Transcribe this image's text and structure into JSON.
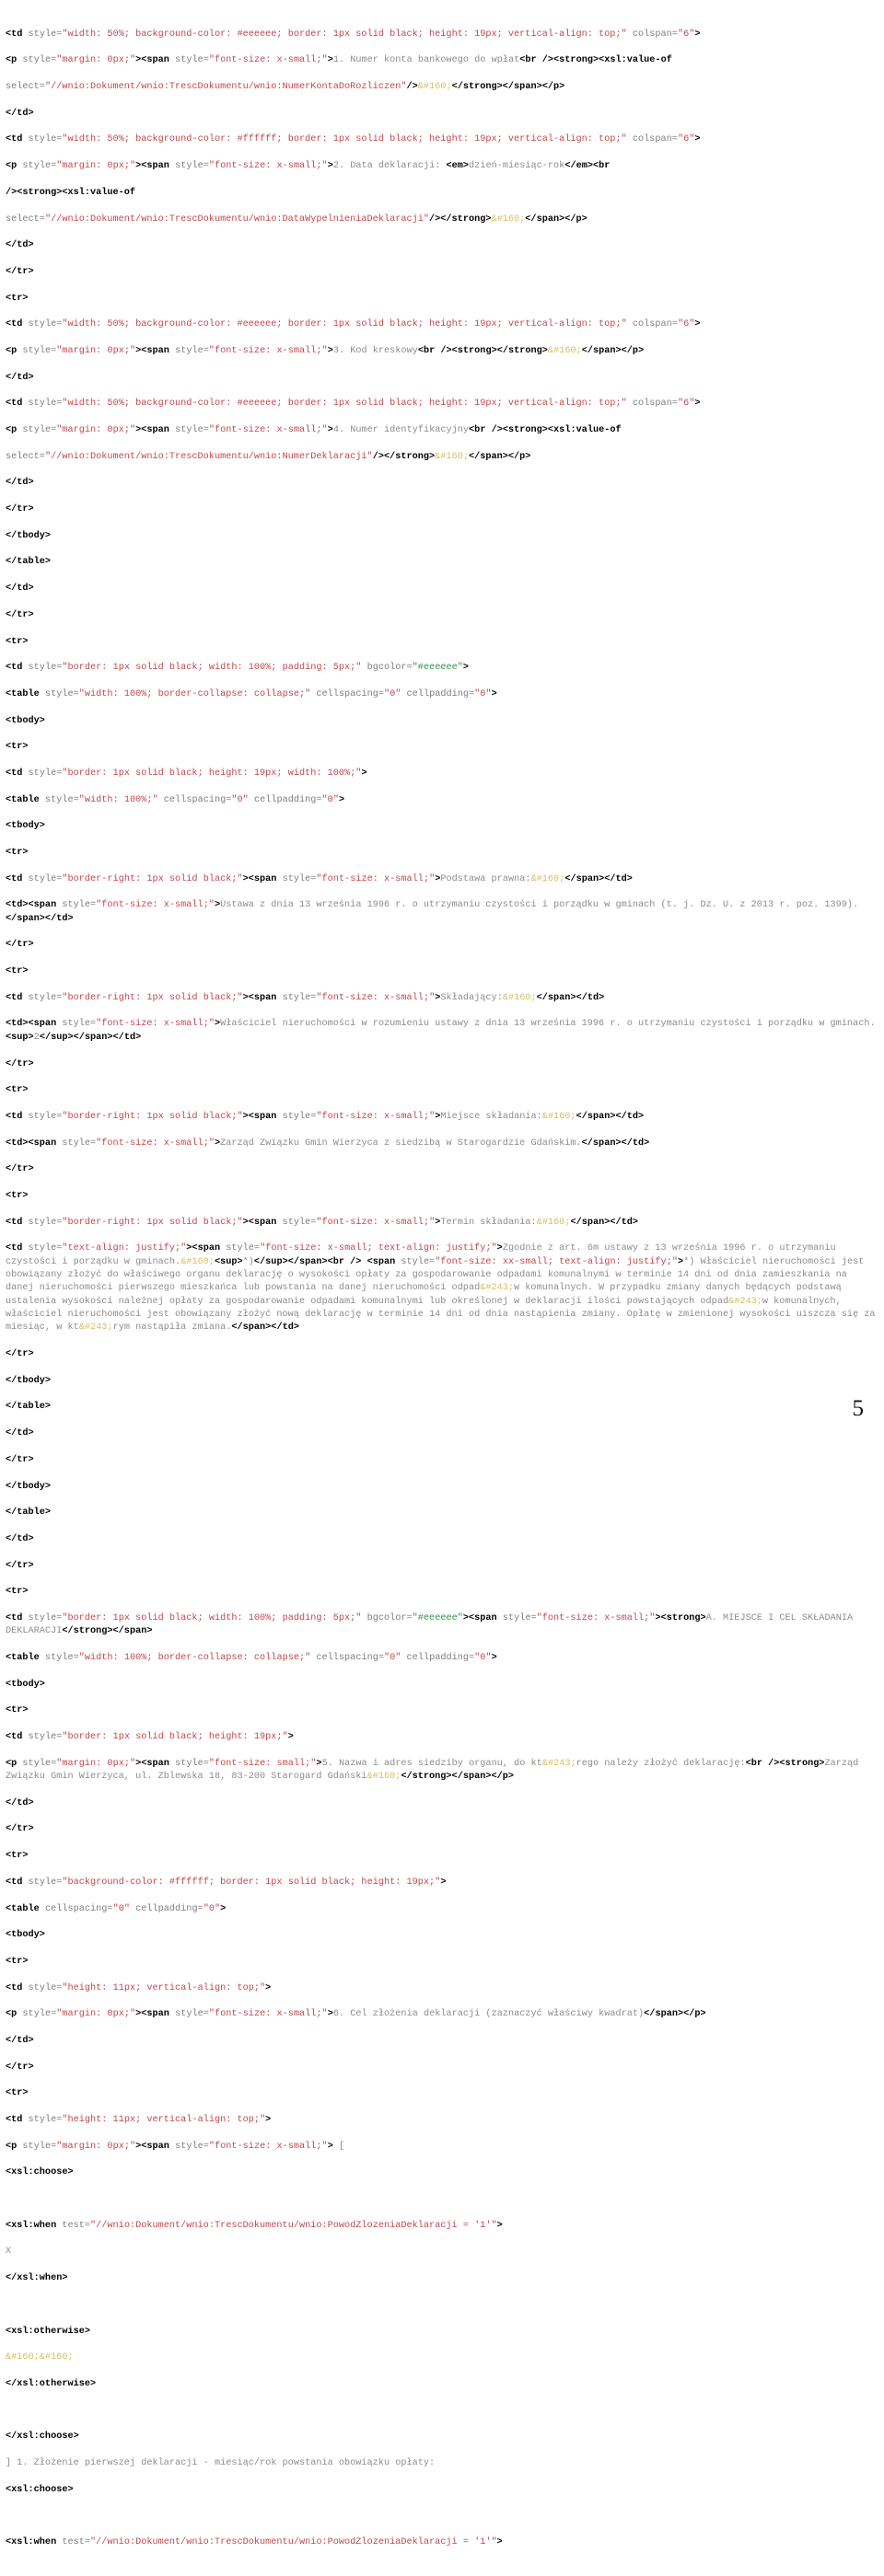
{
  "document": {
    "kind": "xslt-source-listing",
    "page_number": "5",
    "language": "XSLT / XHTML",
    "colors": {
      "background": "#ffffff",
      "tag": "#000000",
      "attribute_name": "#7d7d7d",
      "attribute_value": "#c2484d",
      "attribute_value_green": "#2f8f4e",
      "text": "#8c8c8c",
      "entity": "#d6bf63"
    }
  },
  "code_lines": [
    "<td style=\"width: 50%; background-color: #eeeeee; border: 1px solid black; height: 19px; vertical-align: top;\" colspan=\"6\">",
    "<p style=\"margin: 0px;\"><span style=\"font-size: x-small;\">1. Numer konta bankowego do wpłat<br /><strong><xsl:value-of",
    "select=\"//wnio:Dokument/wnio:TrescDokumentu/wnio:NumerKontaDoRozliczen\"/>&#160;</strong></span></p>",
    "</td>",
    "<td style=\"width: 50%; background-color: #ffffff; border: 1px solid black; height: 19px; vertical-align: top;\" colspan=\"6\">",
    "<p style=\"margin: 0px;\"><span style=\"font-size: x-small;\">2. Data deklaracji: <em>dzień-miesiąc-rok</em><br",
    "/><strong><xsl:value-of",
    "select=\"//wnio:Dokument/wnio:TrescDokumentu/wnio:DataWypelnieniaDeklaracji\"/></strong>&#160;</span></p>",
    "</td>",
    "</tr>",
    "<tr>",
    "<td style=\"width: 50%; background-color: #eeeeee; border: 1px solid black; height: 19px; vertical-align: top;\" colspan=\"6\">",
    "<p style=\"margin: 0px;\"><span style=\"font-size: x-small;\">3. Kod kreskowy<br /><strong></strong>&#160;</span></p>",
    "</td>",
    "<td style=\"width: 50%; background-color: #eeeeee; border: 1px solid black; height: 19px; vertical-align: top;\" colspan=\"6\">",
    "<p style=\"margin: 0px;\"><span style=\"font-size: x-small;\">4. Numer identyfikacyjny<br /><strong><xsl:value-of",
    "select=\"//wnio:Dokument/wnio:TrescDokumentu/wnio:NumerDeklaracji\"/></strong>&#160;</span></p>",
    "</td>",
    "</tr>",
    "</tbody>",
    "</table>",
    "</td>",
    "</tr>",
    "<tr>",
    "<td style=\"border: 1px solid black; width: 100%; padding: 5px;\" bgcolor=\"#eeeeee\">",
    "<table style=\"width: 100%; border-collapse: collapse;\" cellspacing=\"0\" cellpadding=\"0\">",
    "<tbody>",
    "<tr>",
    "<td style=\"border: 1px solid black; height: 19px; width: 100%;\">",
    "<table style=\"width: 100%;\" cellspacing=\"0\" cellpadding=\"0\">",
    "<tbody>",
    "<tr>",
    "<td style=\"border-right: 1px solid black;\"><span style=\"font-size: x-small;\">Podstawa prawna:&#160;</span></td>",
    "<td><span style=\"font-size: x-small;\">Ustawa z dnia 13 września 1996 r. o utrzymaniu czystości i porządku w gminach (t. j. Dz. U. z 2013 r. poz. 1399).</span></td>",
    "</tr>",
    "<tr>",
    "<td style=\"border-right: 1px solid black;\"><span style=\"font-size: x-small;\">Składający:&#160;</span></td>",
    "<td><span style=\"font-size: x-small;\">Właściciel nieruchomości w rozumieniu ustawy z dnia 13 września 1996 r. o utrzymaniu czystości i porządku w gminach.<sup>2</sup></span></td>",
    "</tr>",
    "<tr>",
    "<td style=\"border-right: 1px solid black;\"><span style=\"font-size: x-small;\">Miejsce składania:&#160;</span></td>",
    "<td><span style=\"font-size: x-small;\">Zarząd Związku Gmin Wierzyca z siedzibą w Starogardzie Gdańskim.</span></td>",
    "</tr>",
    "<tr>",
    "<td style=\"border-right: 1px solid black;\"><span style=\"font-size: x-small;\">Termin składania:&#160;</span></td>",
    "<td style=\"text-align: justify;\"><span style=\"font-size: x-small; text-align: justify;\">Zgodnie z art. 6m ustawy z 13 września 1996 r. o utrzymaniu czystości i porządku w gminach.&#160;<sup>*)</sup></span><br /> <span style=\"font-size: xx-small; text-align: justify;\">*) Właściciel nieruchomości jest obowiązany złożyć do właściwego organu deklarację o wysokości opłaty za gospodarowanie odpadami komunalnymi w terminie 14 dni od dnia zamieszkania na danej nieruchomości pierwszego mieszkańca lub powstania na danej nieruchomości odpad&#243;w komunalnych. W przypadku zmiany danych będących podstawą ustalenia wysokości należnej opłaty za gospodarowanie odpadami komunalnymi lub określonej w deklaracji ilości powstających odpad&#243;w komunalnych, właściciel nieruchomości jest obowiązany złożyć nową deklarację w terminie 14 dni od dnia nastąpienia zmiany. Opłatę w zmienionej wysokości uiszcza się za miesiąc, w kt&#243;rym nastąpiła zmiana.</span></td>",
    "</tr>",
    "</tbody>",
    "</table>",
    "</td>",
    "</tr>",
    "</tbody>",
    "</table>",
    "</td>",
    "</tr>",
    "<tr>",
    "<td style=\"border: 1px solid black; width: 100%; padding: 5px;\" bgcolor=\"#eeeeee\"><span style=\"font-size: x-small;\"><strong>A. MIEJSCE I CEL SKŁADANIA DEKLARACJI</strong></span>",
    "<table style=\"width: 100%; border-collapse: collapse;\" cellspacing=\"0\" cellpadding=\"0\">",
    "<tbody>",
    "<tr>",
    "<td style=\"border: 1px solid black; height: 19px;\">",
    "<p style=\"margin: 0px;\"><span style=\"font-size: small;\">5. Nazwa i adres siedziby organu, do kt&#243;rego należy złożyć deklarację:<br /><strong>Zarząd Związku Gmin Wierzyca, ul. Zblewska 18, 83-200 Starogard Gdański&#160;</strong></span></p>",
    "</td>",
    "</tr>",
    "<tr>",
    "<td style=\"background-color: #ffffff; border: 1px solid black; height: 19px;\">",
    "<table cellspacing=\"0\" cellpadding=\"0\">",
    "<tbody>",
    "<tr>",
    "<td style=\"height: 11px; vertical-align: top;\">",
    "<p style=\"margin: 0px;\"><span style=\"font-size: x-small;\">6. Cel złożenia deklaracji (zaznaczyć właściwy kwadrat)</span></p>",
    "</td>",
    "</tr>",
    "<tr>",
    "<td style=\"height: 11px; vertical-align: top;\">",
    "<p style=\"margin: 0px;\"><span style=\"font-size: x-small;\"> [",
    "<xsl:choose>",
    "",
    "<xsl:when test=\"//wnio:Dokument/wnio:TrescDokumentu/wnio:PowodZlozeniaDeklaracji = '1'\">",
    "X",
    "</xsl:when>",
    "",
    "<xsl:otherwise>",
    "&#160;&#160;",
    "</xsl:otherwise>",
    "",
    "</xsl:choose>",
    "] 1. Złożenie pierwszej deklaracji - miesiąc/rok powstania obowiązku opłaty:",
    "<xsl:choose>",
    "",
    "<xsl:when test=\"//wnio:Dokument/wnio:TrescDokumentu/wnio:PowodZlozeniaDeklaracji = '1'\">"
  ]
}
